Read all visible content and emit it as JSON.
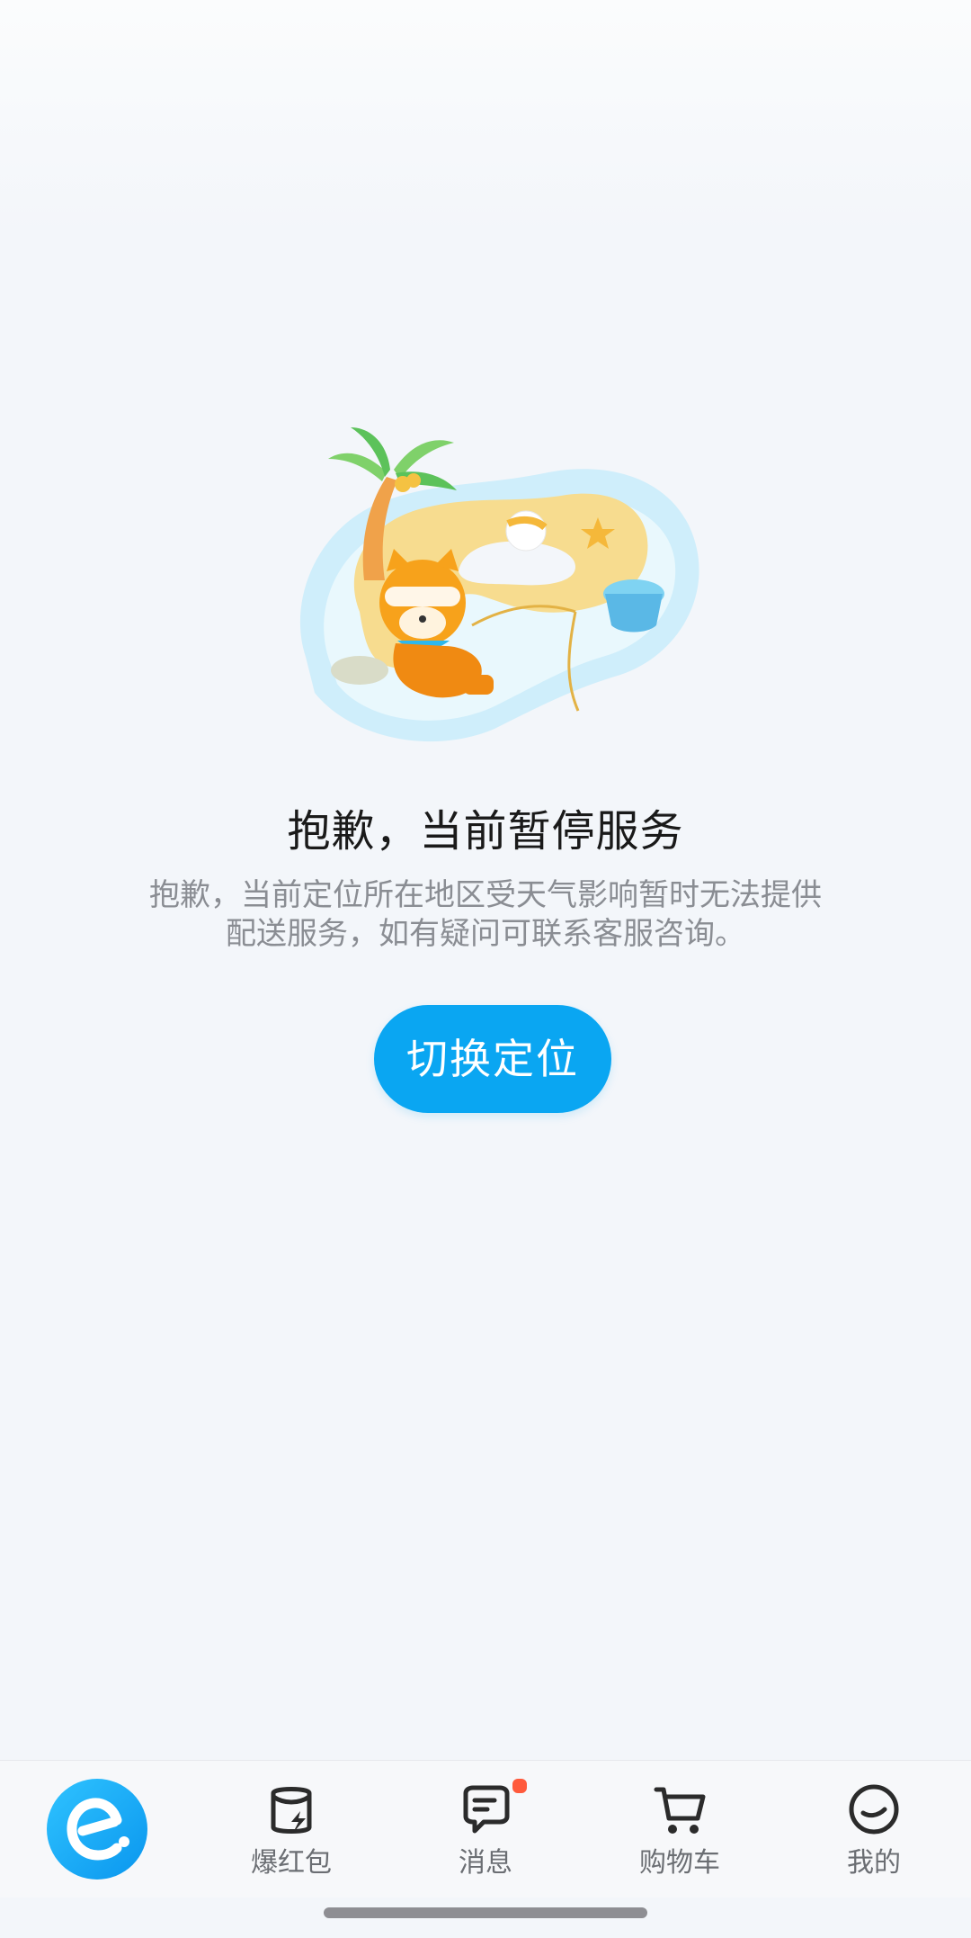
{
  "empty_state": {
    "title": "抱歉，当前暂停服务",
    "description_line1": "抱歉，当前定位所在地区受天气影响暂时无法提供",
    "description_line2": "配送服务，如有疑问可联系客服咨询。",
    "button_label": "切换定位",
    "illustration": "mascot-on-island"
  },
  "tabbar": {
    "tabs": [
      {
        "id": "home",
        "label": "",
        "icon": "eleme-logo-icon",
        "active": true
      },
      {
        "id": "red-packet",
        "label": "爆红包",
        "icon": "red-packet-icon"
      },
      {
        "id": "messages",
        "label": "消息",
        "icon": "message-icon",
        "badge": "dot"
      },
      {
        "id": "cart",
        "label": "购物车",
        "icon": "cart-icon"
      },
      {
        "id": "mine",
        "label": "我的",
        "icon": "profile-icon"
      }
    ]
  },
  "colors": {
    "accent": "#0aa6f2",
    "badge": "#ff5a3c",
    "title_text": "#1a1a1a",
    "secondary_text": "#8a8d93",
    "background": "#f3f6fa"
  }
}
